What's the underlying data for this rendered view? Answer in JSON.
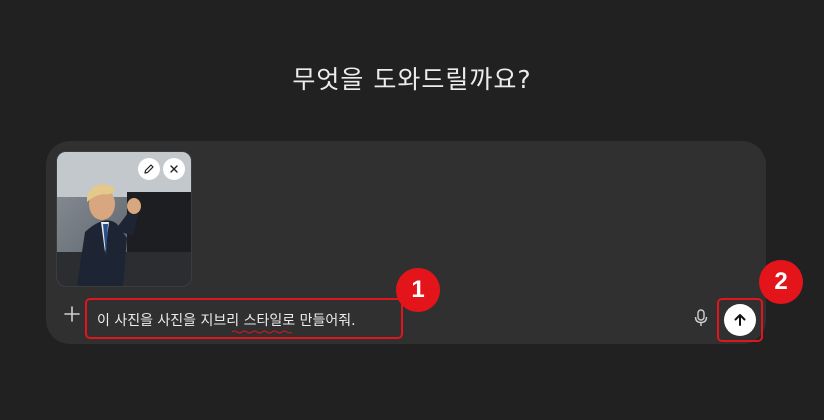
{
  "heading": "무엇을 도와드릴까요?",
  "composer": {
    "attachment": {
      "edit_icon": "pencil-icon",
      "remove_icon": "close-icon"
    },
    "add_icon": "plus-icon",
    "prompt_text": "이 사진을 사진을 지브리 스타일로 만들어줘.",
    "mic_icon": "microphone-icon",
    "send_icon": "arrow-up-icon"
  },
  "annotations": {
    "marker_1": "1",
    "marker_2": "2",
    "highlight_color": "#e0161c"
  }
}
